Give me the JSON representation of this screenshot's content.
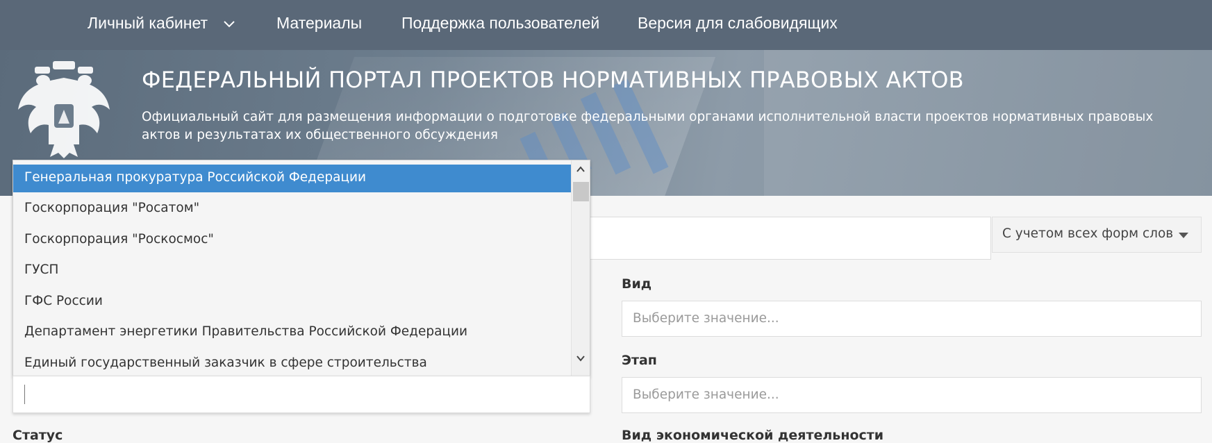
{
  "nav": {
    "cabinet": "Личный кабинет",
    "materials": "Материалы",
    "support": "Поддержка пользователей",
    "accessibility": "Версия для слабовидящих"
  },
  "hero": {
    "title": "ФЕДЕРАЛЬНЫЙ ПОРТАЛ ПРОЕКТОВ НОРМАТИВНЫХ ПРАВОВЫХ АКТОВ",
    "subtitle": "Официальный сайт для размещения информации о подготовке федеральными органами исполнительной власти проектов нормативных правовых актов и результатах их общественного обсуждения"
  },
  "search": {
    "morphology": "С учетом всех форм слов"
  },
  "fields": {
    "vid_label": "Вид",
    "vid_placeholder": "Выберите значение...",
    "etap_label": "Этап",
    "etap_placeholder": "Выберите значение...",
    "status_label": "Статус",
    "okved_label": "Вид экономической деятельности"
  },
  "dropdown": {
    "options": [
      "Генеральная прокуратура Российской Федерации",
      "Госкорпорация \"Росатом\"",
      "Госкорпорация \"Роскосмос\"",
      "ГУСП",
      "ГФС России",
      "Департамент энергетики Правительства Российской Федерации",
      "Единый государственный заказчик в сфере строительства"
    ],
    "selected_index": 0
  },
  "colors": {
    "nav_bg": "#5a6878",
    "selected_option": "#3f8bcf"
  }
}
